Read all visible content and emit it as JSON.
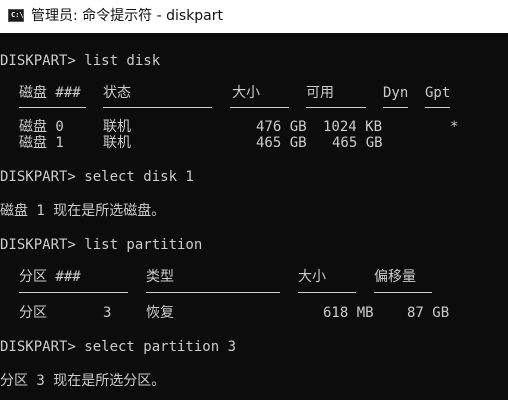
{
  "window": {
    "icon_text": "C:\\",
    "title": "管理员: 命令提示符 - diskpart"
  },
  "console": {
    "cmd1": "DISKPART> list disk",
    "disk_table": {
      "headers": [
        "磁盘 ###",
        "状态",
        "大小",
        "可用",
        "Dyn",
        "Gpt"
      ],
      "rows": [
        [
          "磁盘 0",
          "联机",
          "476 GB",
          "1024 KB",
          "",
          "*"
        ],
        [
          "磁盘 1",
          "联机",
          "465 GB",
          "465 GB",
          "",
          ""
        ]
      ]
    },
    "cmd2": "DISKPART> select disk 1",
    "msg2": "磁盘 1 现在是所选磁盘。",
    "cmd3": "DISKPART> list partition",
    "part_table": {
      "headers": [
        "分区 ###",
        "类型",
        "大小",
        "偏移量"
      ],
      "rows": [
        [
          "分区",
          "3",
          "恢复",
          "618 MB",
          "87 GB"
        ]
      ]
    },
    "cmd4": "DISKPART> select partition 3",
    "msg4": "分区 3 现在是所选分区。"
  },
  "colors": {
    "console_bg": "#0c0c0c",
    "console_text": "#cccccc",
    "titlebar_bg": "#ffffff"
  }
}
